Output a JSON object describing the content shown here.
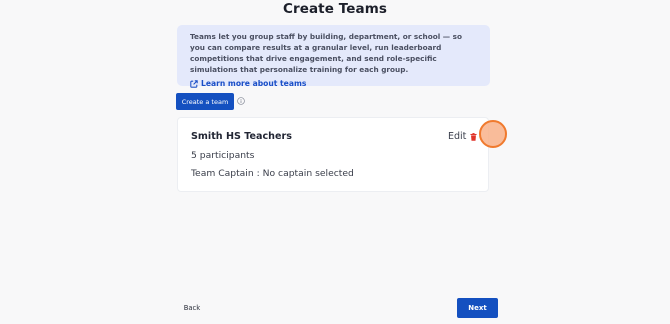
{
  "page": {
    "title": "Create Teams"
  },
  "info": {
    "description": "Teams let you group staff by building, department, or school — so you can compare results at a granular level, run leaderboard competitions that drive engagement, and send role-specific simulations that personalize training for each group.",
    "learn_more": "Learn more about teams",
    "link_icon": "external-link-icon"
  },
  "toolbar": {
    "create_team": "Create a team",
    "help_icon": "info-circle-icon"
  },
  "team": {
    "name": "Smith HS Teachers",
    "edit": "Edit",
    "delete_icon": "trash-icon",
    "participants": "5 participants",
    "captain": "Team Captain : No captain selected"
  },
  "footer": {
    "back": "Back",
    "next": "Next"
  },
  "colors": {
    "primary": "#1450c0",
    "info_bg": "#e4e9fb",
    "danger": "#e0342a",
    "cursor_highlight": "#f07a2e"
  }
}
